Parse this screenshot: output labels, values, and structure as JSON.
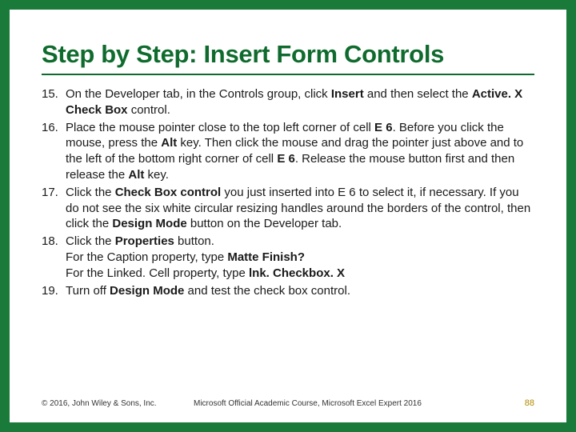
{
  "title": "Step by Step: Insert Form Controls",
  "items": [
    {
      "num": "15.",
      "html": "On the Developer tab, in the Controls group, click <b>Insert</b> and then select the <b>Active. X Check Box</b> control."
    },
    {
      "num": "16.",
      "html": "Place the mouse pointer close to the top left corner of cell <b>E 6</b>. Before you click the mouse, press the <b>Alt</b> key. Then click the mouse and drag the pointer just above and to the left of the bottom right corner of cell <b>E 6</b>. Release the mouse button first and then release the <b>Alt</b> key."
    },
    {
      "num": "17.",
      "html": "Click the <b>Check Box control</b> you just inserted into E 6 to select it, if necessary. If you do not see the six white circular resizing handles around the borders of the control, then click the <b>Design Mode</b> button on the Developer tab."
    },
    {
      "num": "18.",
      "html": "Click the <b>Properties</b> button.<br>For the Caption property, type <b>Matte Finish?</b><br>For the Linked. Cell property, type <b>lnk. Checkbox. X</b>"
    },
    {
      "num": "19.",
      "html": "Turn off <b>Design Mode</b> and test the check box control."
    }
  ],
  "footer": {
    "left": "© 2016, John Wiley & Sons, Inc.",
    "center": "Microsoft Official Academic Course, Microsoft Excel Expert 2016",
    "right": "88"
  }
}
